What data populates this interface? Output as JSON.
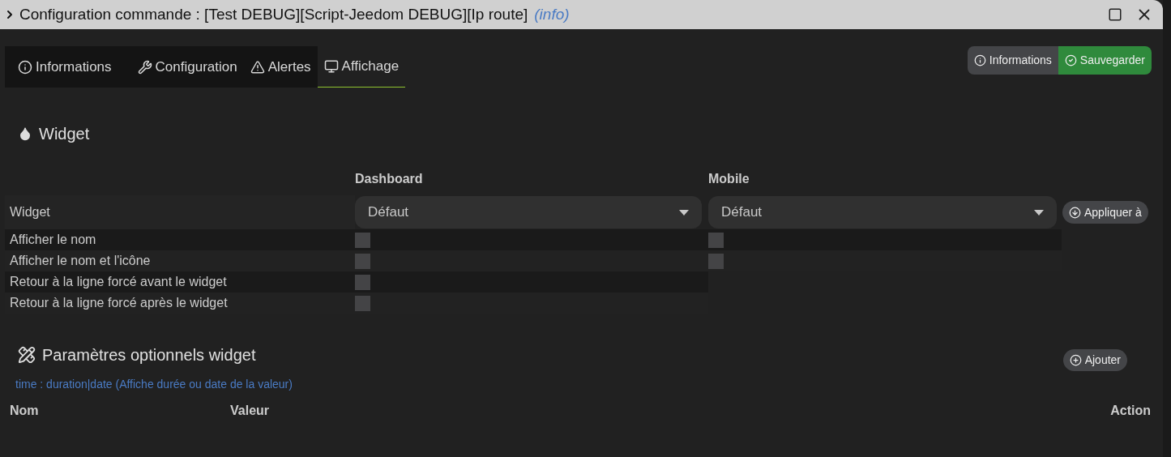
{
  "window": {
    "title": "Configuration commande : [Test DEBUG][Script-Jeedom DEBUG][Ip route]",
    "subtitle": "(info)"
  },
  "tabs": [
    {
      "label": "Informations",
      "kind": "info",
      "selected": false
    },
    {
      "label": "Configuration",
      "kind": "wrench",
      "selected": false
    },
    {
      "label": "Alertes",
      "kind": "warning",
      "selected": false
    },
    {
      "label": "Affichage",
      "kind": "monitor",
      "selected": true
    }
  ],
  "actions": [
    {
      "label": "Informations",
      "kind": "info"
    },
    {
      "label": "Sauvegarder",
      "kind": "save"
    }
  ],
  "widget_section": {
    "title": "Widget",
    "columns": [
      "Dashboard",
      "Mobile"
    ],
    "select_row": {
      "label": "Widget",
      "dashboard": "Défaut",
      "mobile": "Défaut",
      "button": "Appliquer à"
    },
    "rows": [
      {
        "label": "Afficher le nom",
        "dashboard_checked": false,
        "mobile_checked": false
      },
      {
        "label": "Afficher le nom et l'icône",
        "dashboard_checked": false,
        "mobile_checked": false
      },
      {
        "label": "Retour à la ligne forcé avant le widget",
        "dashboard_checked": false
      },
      {
        "label": "Retour à la ligne forcé après le widget",
        "dashboard_checked": false
      }
    ]
  },
  "params_section": {
    "title": "Paramètres optionnels widget",
    "button": "Ajouter",
    "hint": "time : duration|date (Affiche durée ou date de la valeur)",
    "columns": [
      "Nom",
      "Valeur",
      "Action"
    ]
  }
}
